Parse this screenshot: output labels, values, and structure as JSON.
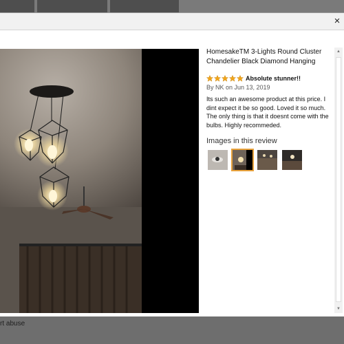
{
  "modal": {
    "close_label": "×",
    "product_title": "HomesakeTM 3-Lights Round Cluster Chandelier Black Diamond Hanging",
    "review": {
      "rating": 5,
      "max_rating": 5,
      "title": "Absolute stunner!!",
      "byline": "By NK on Jun 13, 2019",
      "body": "Its such an awesome product at this price. I dint expect it be so good. Loved it so much. The only thing is that it doesnt come with the bulbs. Highly recommeded."
    },
    "images_heading": "Images in this review",
    "thumbnails": [
      {
        "name": "thumbnail-1",
        "selected": false
      },
      {
        "name": "thumbnail-2",
        "selected": true
      },
      {
        "name": "thumbnail-3",
        "selected": false
      },
      {
        "name": "thumbnail-4",
        "selected": false
      }
    ]
  },
  "background_page": {
    "abuse_link": "rt abuse"
  },
  "colors": {
    "star": "#f2a51a",
    "selected_border": "#e9a23b",
    "overlay": "#6b6b6b"
  },
  "icons": {
    "close": "close-icon",
    "star": "star-icon"
  }
}
